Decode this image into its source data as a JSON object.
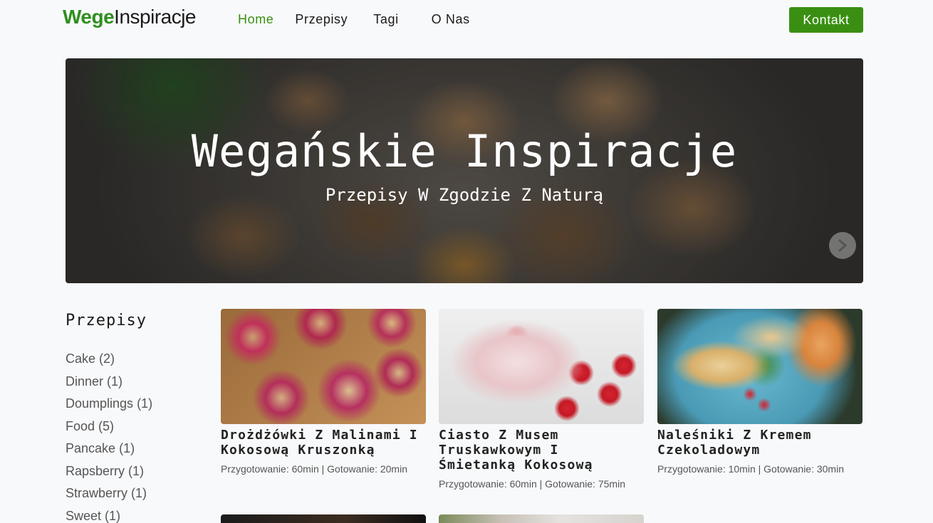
{
  "nav": {
    "logo_part1": "Wege",
    "logo_part2": "Inspiracje",
    "items": [
      {
        "label": "Home",
        "active": true
      },
      {
        "label": "Przepisy",
        "active": false
      },
      {
        "label": "Tagi",
        "active": false
      },
      {
        "label": "O Nas",
        "active": false
      }
    ],
    "cta_label": "Kontakt"
  },
  "hero": {
    "title": "Wegańskie Inspiracje",
    "subtitle": "Przepisy W Zgodzie Z Naturą",
    "next_icon": "chevron-right-icon"
  },
  "sidebar": {
    "title": "Przepisy",
    "categories": [
      {
        "label": "Cake",
        "count": "(2)"
      },
      {
        "label": "Dinner",
        "count": "(1)"
      },
      {
        "label": "Doumplings",
        "count": "(1)"
      },
      {
        "label": "Food",
        "count": "(5)"
      },
      {
        "label": "Pancake",
        "count": "(1)"
      },
      {
        "label": "Rapsberry",
        "count": "(1)"
      },
      {
        "label": "Strawberry",
        "count": "(1)"
      },
      {
        "label": "Sweet",
        "count": "(1)"
      }
    ]
  },
  "recipes": [
    {
      "title": "Drożdżówki Z Malinami I Kokosową Kruszonką",
      "meta": "Przygotowanie: 60min | Gotowanie: 20min"
    },
    {
      "title": "Ciasto Z Musem Truskawkowym I Śmietanką Kokosową",
      "meta": "Przygotowanie: 60min | Gotowanie: 75min"
    },
    {
      "title": "Naleśniki Z Kremem Czekoladowym",
      "meta": "Przygotowanie: 10min | Gotowanie: 30min"
    }
  ],
  "colors": {
    "accent": "#3a8f12",
    "logo_green": "#2f8f1e",
    "background": "#f8f9fb"
  }
}
